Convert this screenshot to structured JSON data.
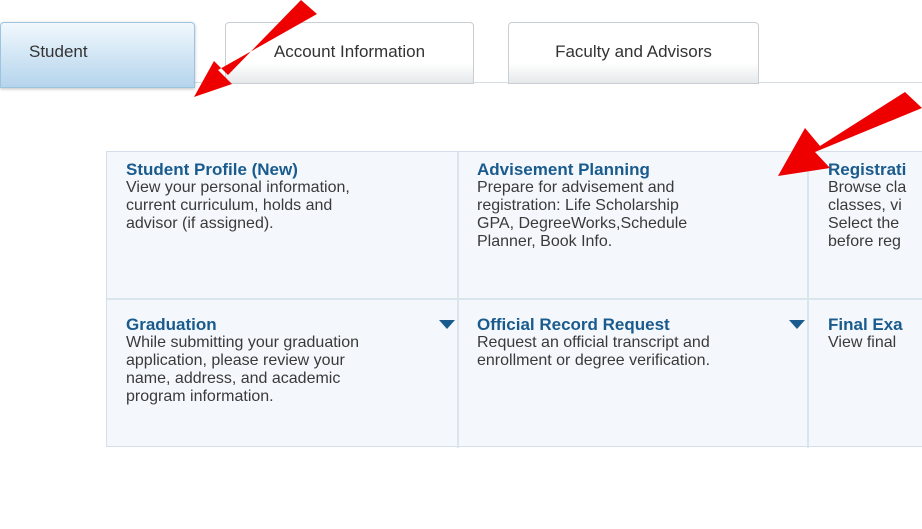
{
  "tabs": [
    {
      "label": "Student"
    },
    {
      "label": "Account Information"
    },
    {
      "label": "Faculty and Advisors"
    }
  ],
  "cards": [
    {
      "title": "Student Profile (New)",
      "desc": [
        "View your personal information,",
        "current curriculum, holds and",
        "advisor (if assigned)."
      ]
    },
    {
      "title": "Advisement Planning",
      "desc": [
        "Prepare for advisement and",
        "registration: Life Scholarship",
        "GPA, DegreeWorks,Schedule",
        "Planner, Book Info."
      ]
    },
    {
      "title": "Registrati",
      "desc": [
        "Browse cla",
        "classes, vi",
        "Select the",
        "before reg"
      ]
    },
    {
      "title": "Graduation",
      "desc": [
        "While submitting your graduation",
        "application, please review your",
        "name, address, and academic",
        "program information."
      ]
    },
    {
      "title": "Official Record Request",
      "desc": [
        "Request an official transcript and",
        "enrollment or degree verification."
      ]
    },
    {
      "title": "Final Exa",
      "desc": [
        "View final"
      ]
    }
  ],
  "colors": {
    "link_blue": "#1a5b8e",
    "annotation_arrow": "#ee0000",
    "active_tab": "#b5d4ec"
  },
  "icons": {
    "dropdown": "caret-down-icon",
    "annotation": "red-arrow-icon"
  }
}
